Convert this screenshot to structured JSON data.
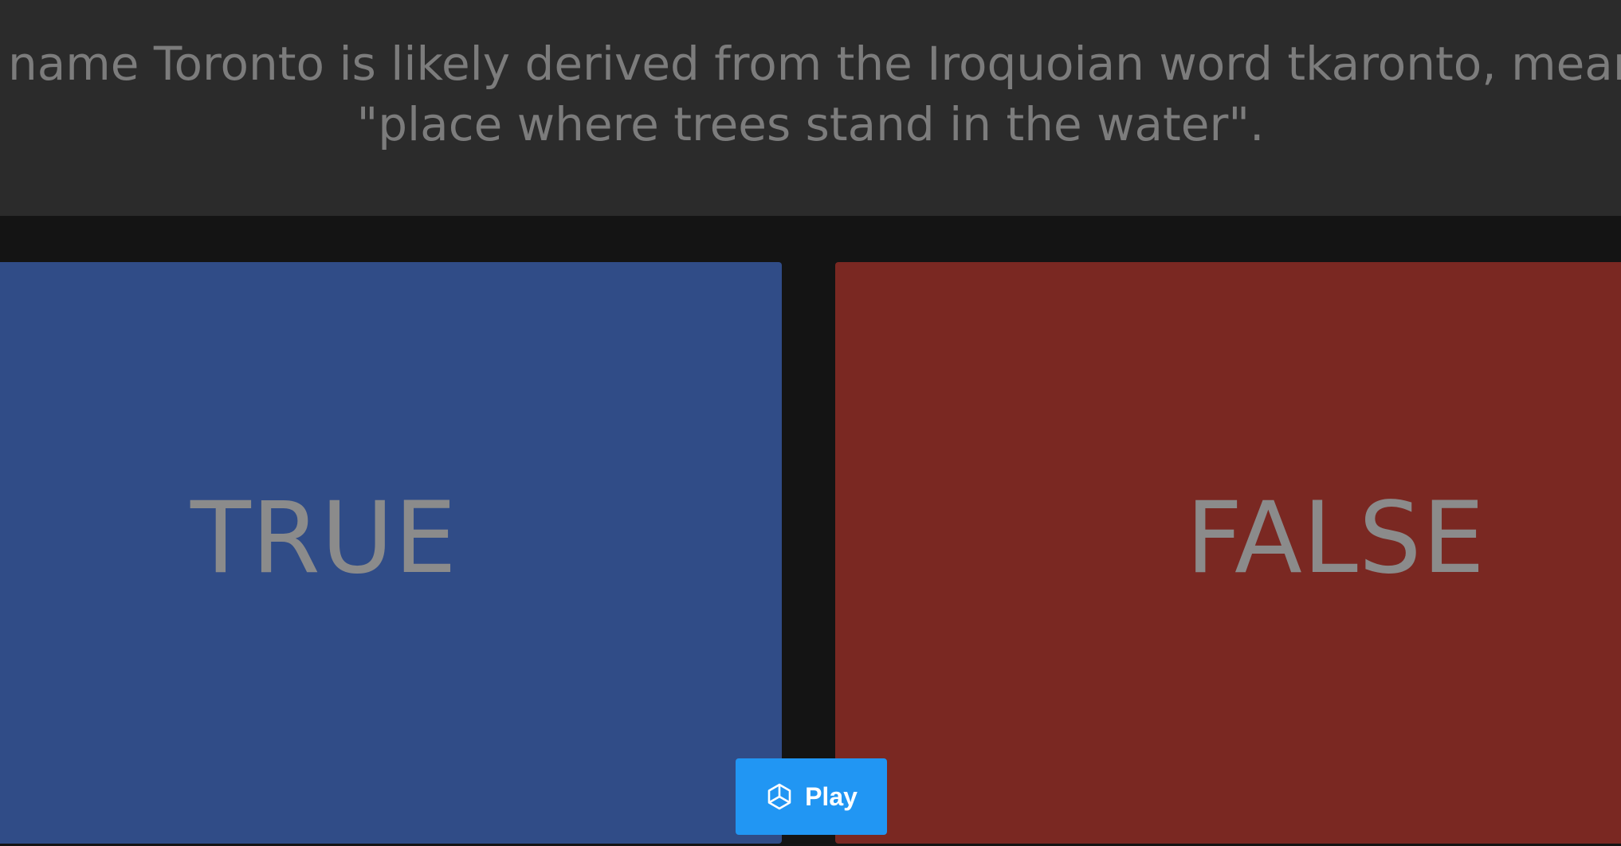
{
  "question": {
    "text": "The name Toronto is likely derived from the Iroquoian word tkaronto, meaning \"place where trees stand in the water\"."
  },
  "answers": [
    {
      "label": "TRUE",
      "color": "#304c87"
    },
    {
      "label": "FALSE",
      "color": "#7a2822"
    }
  ],
  "play_button": {
    "label": "Play",
    "icon": "unity-logo-icon",
    "color": "#2196f3"
  },
  "colors": {
    "page_background": "#141414",
    "question_panel": "#2b2b2b",
    "question_text": "#7c7c7c",
    "answer_text": "#8b8b8b"
  }
}
